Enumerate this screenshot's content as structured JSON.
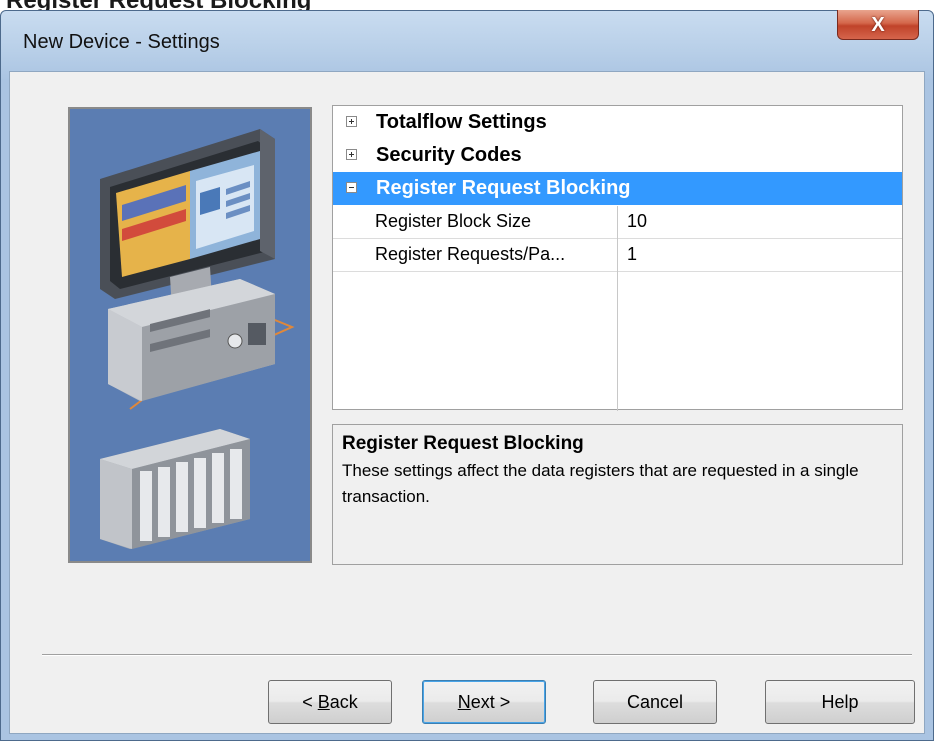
{
  "heading_cropped": "Register Request Blocking",
  "window": {
    "title": "New Device - Settings",
    "close_glyph": "X"
  },
  "property_grid": {
    "categories": [
      {
        "label": "Totalflow Settings",
        "expander": "plus",
        "selected": false
      },
      {
        "label": "Security Codes",
        "expander": "plus",
        "selected": false
      },
      {
        "label": "Register Request Blocking",
        "expander": "minus",
        "selected": true
      }
    ],
    "properties": [
      {
        "name": "Register Block Size",
        "value": "10"
      },
      {
        "name": "Register Requests/Pa...",
        "value": "1"
      }
    ]
  },
  "description": {
    "title": "Register Request Blocking",
    "body": "These settings affect the data registers that are requested in a single transaction."
  },
  "buttons": {
    "back": {
      "prefix": "< ",
      "mnemonic": "B",
      "rest": "ack"
    },
    "next": {
      "mnemonic": "N",
      "rest": "ext >"
    },
    "cancel": "Cancel",
    "help": "Help"
  },
  "colors": {
    "selection": "#3399ff",
    "image_background": "#5b7db2"
  },
  "icons": {
    "expand": "plus-box-icon",
    "collapse": "minus-box-icon",
    "close": "close-icon"
  }
}
